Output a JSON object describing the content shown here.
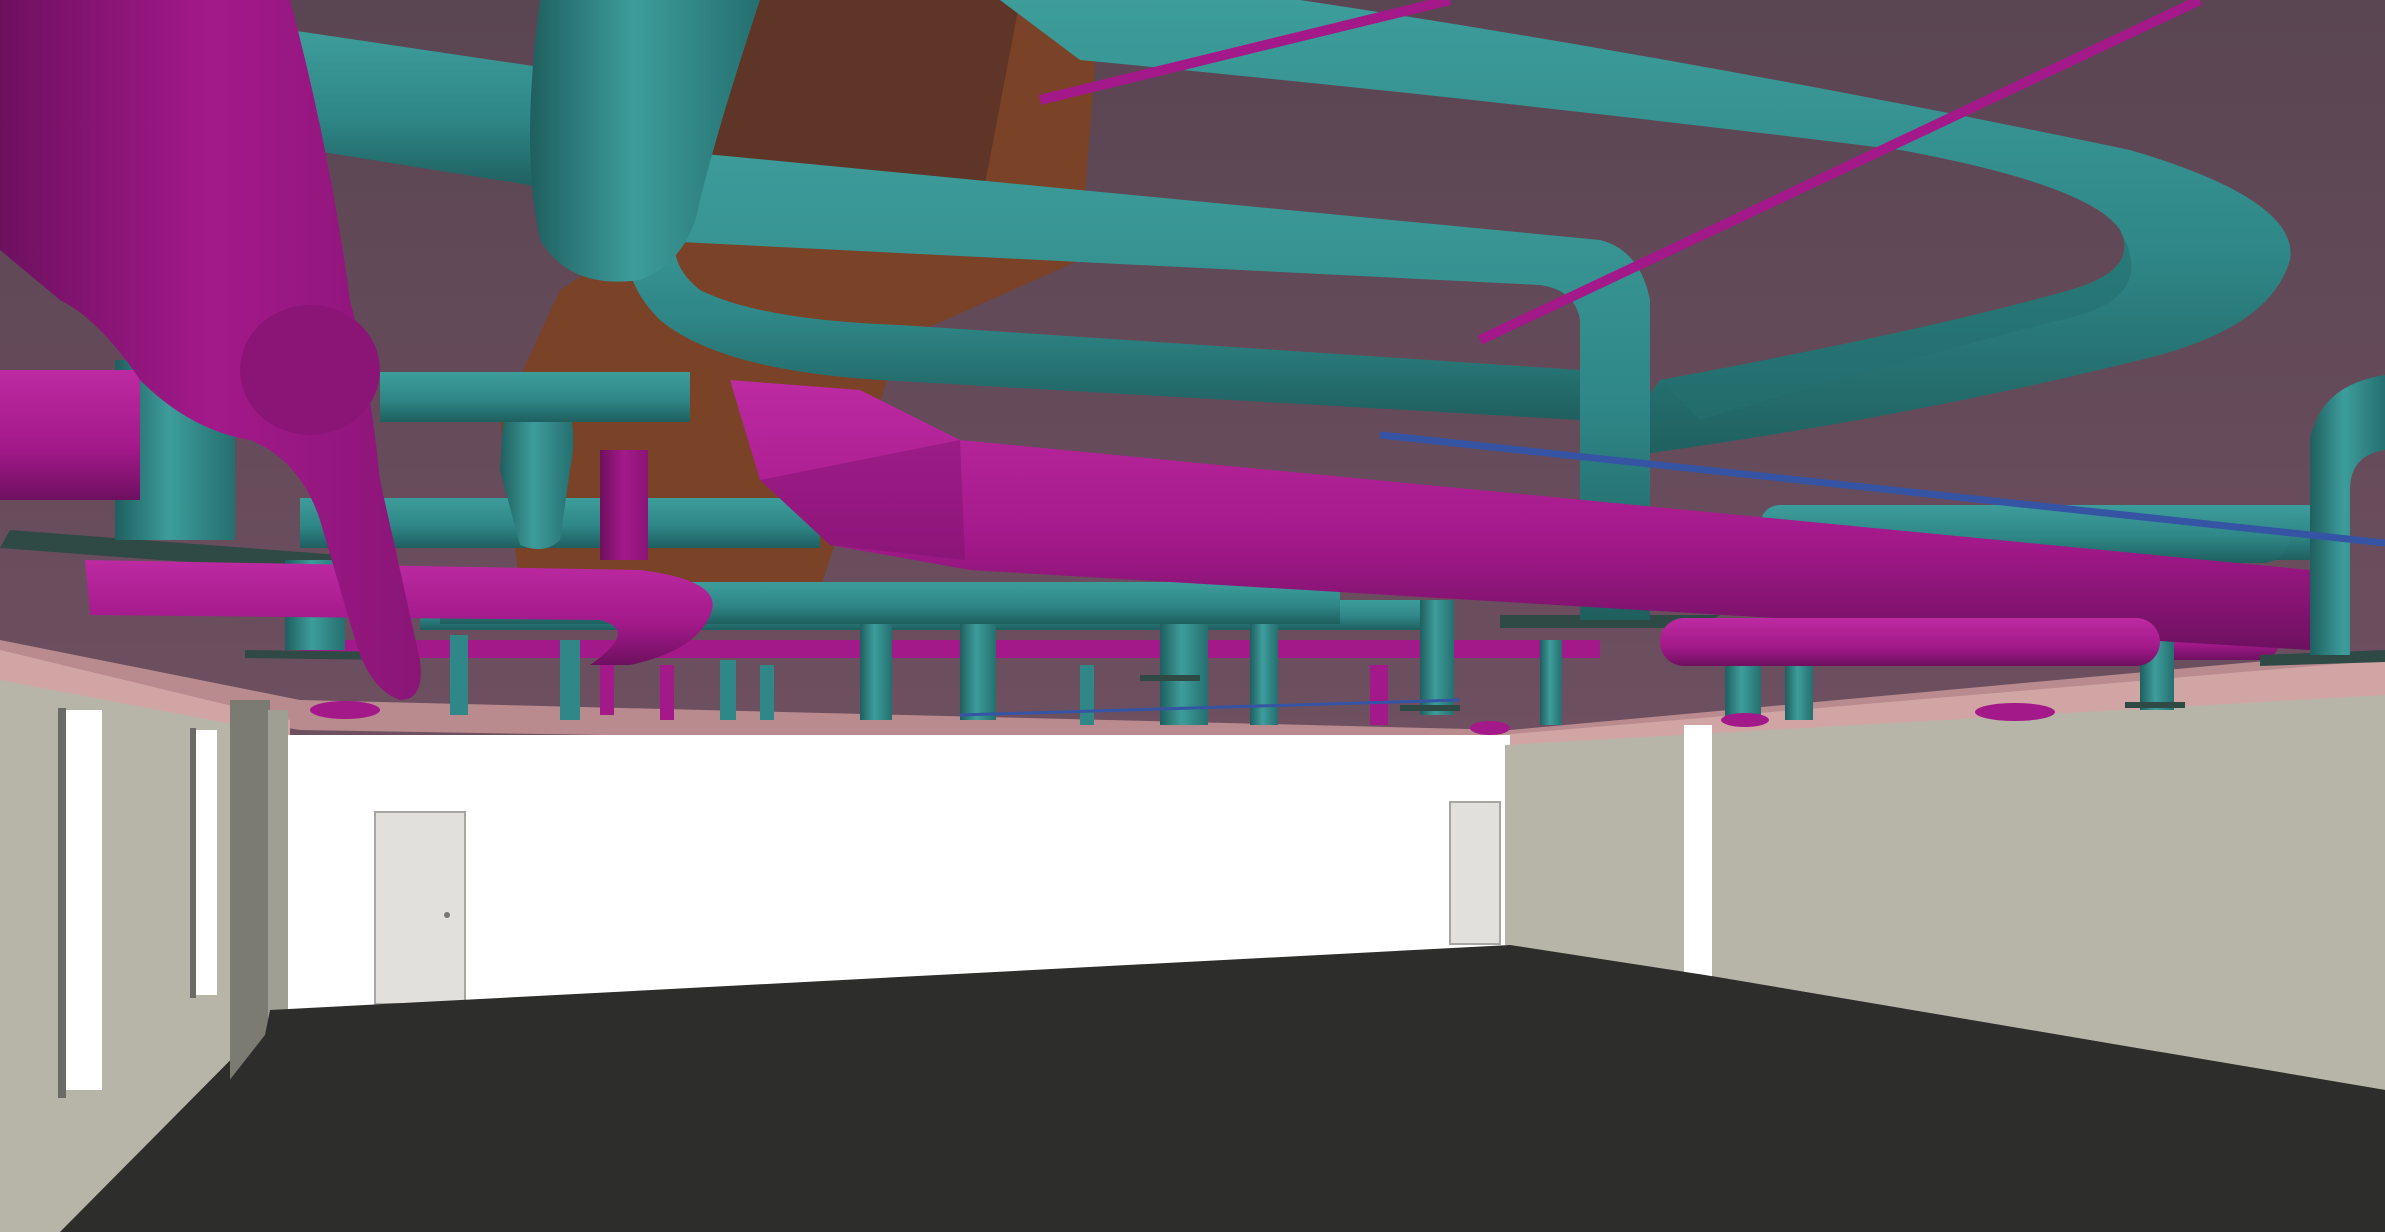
{
  "scene": {
    "type": "3d-bim-viewport",
    "description_visible_text": "",
    "palette": {
      "ceiling": "#5a4552",
      "ceiling_slab_edge": "#c99a9a",
      "wall_light": "#b7b5a7",
      "wall_white": "#ffffff",
      "floor": "#2d2d2b",
      "door": "#e2e0dc",
      "duct_teal": "#2f8787",
      "duct_teal_dark": "#1f5f5f",
      "duct_teal_light": "#3d9d9b",
      "duct_magenta": "#a3198a",
      "duct_magenta_dark": "#6e1060",
      "duct_magenta_light": "#bd2aa2",
      "structure_orange": "#7a4227",
      "cable_blue": "#3554a4"
    }
  }
}
